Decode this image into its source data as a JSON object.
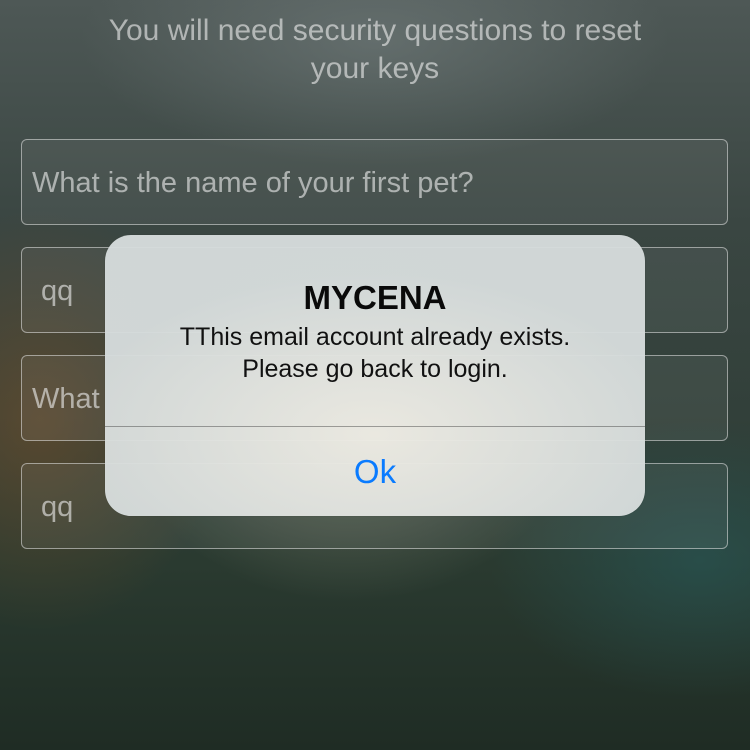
{
  "header": {
    "line1": "You will need security questions to reset",
    "line2": "your keys"
  },
  "form": {
    "question1_placeholder": "What is the name of your first pet?",
    "answer1_value": "qq",
    "question2_value": "What",
    "answer2_value": "qq"
  },
  "alert": {
    "title": "MYCENA",
    "message_line1": "TThis email account already exists.",
    "message_line2": "Please go back to login.",
    "ok_label": "Ok"
  },
  "colors": {
    "accent": "#0a7bff"
  }
}
